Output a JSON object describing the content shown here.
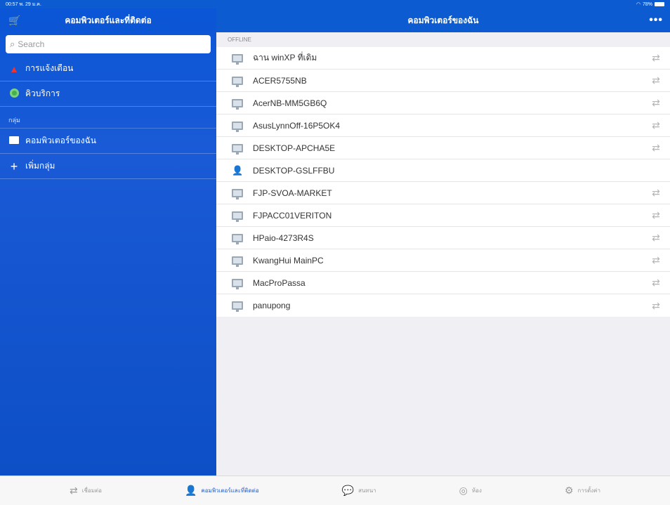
{
  "status": {
    "time": "00:57",
    "date": "พ. 29 ม.ค.",
    "wifi": "wifi",
    "battery": "78%"
  },
  "sidebar": {
    "title": "คอมพิวเตอร์และที่ติดต่อ",
    "search_placeholder": "Search",
    "items": [
      {
        "label": "การแจ้งเตือน",
        "icon": "warning-icon"
      },
      {
        "label": "คิวบริการ",
        "icon": "service-icon"
      }
    ],
    "group_label": "กลุ่ม",
    "groups": [
      {
        "label": "คอมพิวเตอร์ของฉัน",
        "icon": "folder-icon"
      },
      {
        "label": "เพิ่มกลุ่ม",
        "icon": "plus-icon"
      }
    ]
  },
  "main": {
    "title": "คอมพิวเตอร์ของฉัน",
    "more": "•••",
    "section": "OFFLINE",
    "computers": [
      {
        "name": "ฉาน winXP ที่เดิม",
        "type": "computer",
        "connect": true
      },
      {
        "name": "ACER5755NB",
        "type": "computer",
        "connect": true
      },
      {
        "name": "AcerNB-MM5GB6Q",
        "type": "computer",
        "connect": true
      },
      {
        "name": "AsusLynnOff-16P5OK4",
        "type": "computer",
        "connect": true
      },
      {
        "name": "DESKTOP-APCHA5E",
        "type": "computer",
        "connect": true
      },
      {
        "name": "DESKTOP-GSLFFBU",
        "type": "user",
        "connect": false
      },
      {
        "name": "FJP-SVOA-MARKET",
        "type": "computer",
        "connect": true
      },
      {
        "name": "FJPACC01VERITON",
        "type": "computer",
        "connect": true
      },
      {
        "name": "HPaio-4273R4S",
        "type": "computer",
        "connect": true
      },
      {
        "name": "KwangHui MainPC",
        "type": "computer",
        "connect": true
      },
      {
        "name": "MacProPassa",
        "type": "computer",
        "connect": true
      },
      {
        "name": "panupong",
        "type": "computer",
        "connect": true
      }
    ]
  },
  "tabs": [
    {
      "label": "เชื่อมต่อ",
      "icon": "connect-icon",
      "active": false
    },
    {
      "label": "คอมพิวเตอร์และที่ติดต่อ",
      "icon": "contacts-icon",
      "active": true
    },
    {
      "label": "สนทนา",
      "icon": "chat-icon",
      "active": false
    },
    {
      "label": "ห้อง",
      "icon": "meeting-icon",
      "active": false
    },
    {
      "label": "การตั้งค่า",
      "icon": "settings-icon",
      "active": false
    }
  ],
  "colors": {
    "accent": "#0c5bd0",
    "sidebar": "#1a5ad6"
  }
}
